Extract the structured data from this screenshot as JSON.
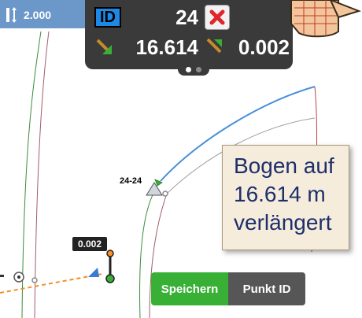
{
  "height_chip": {
    "value": "2.000"
  },
  "panel": {
    "id_label": "ID",
    "point_id": "24",
    "distance": "16.614",
    "offset": "0.002",
    "page_dots": [
      "active",
      "inactive"
    ]
  },
  "map": {
    "point_label": "24-24",
    "value_tag": "0.002"
  },
  "note": {
    "lines": [
      "Bogen auf",
      "16.614 m",
      "verlängert"
    ]
  },
  "buttons": {
    "save_label": "Speichern",
    "point_id_label": "Punkt ID"
  },
  "colors": {
    "accent_blue": "#6b97c9",
    "panel_bg": "#3a3a3a",
    "save_green": "#37b035",
    "arc_blue": "#4a90d9",
    "note_text": "#1e2f6a"
  }
}
